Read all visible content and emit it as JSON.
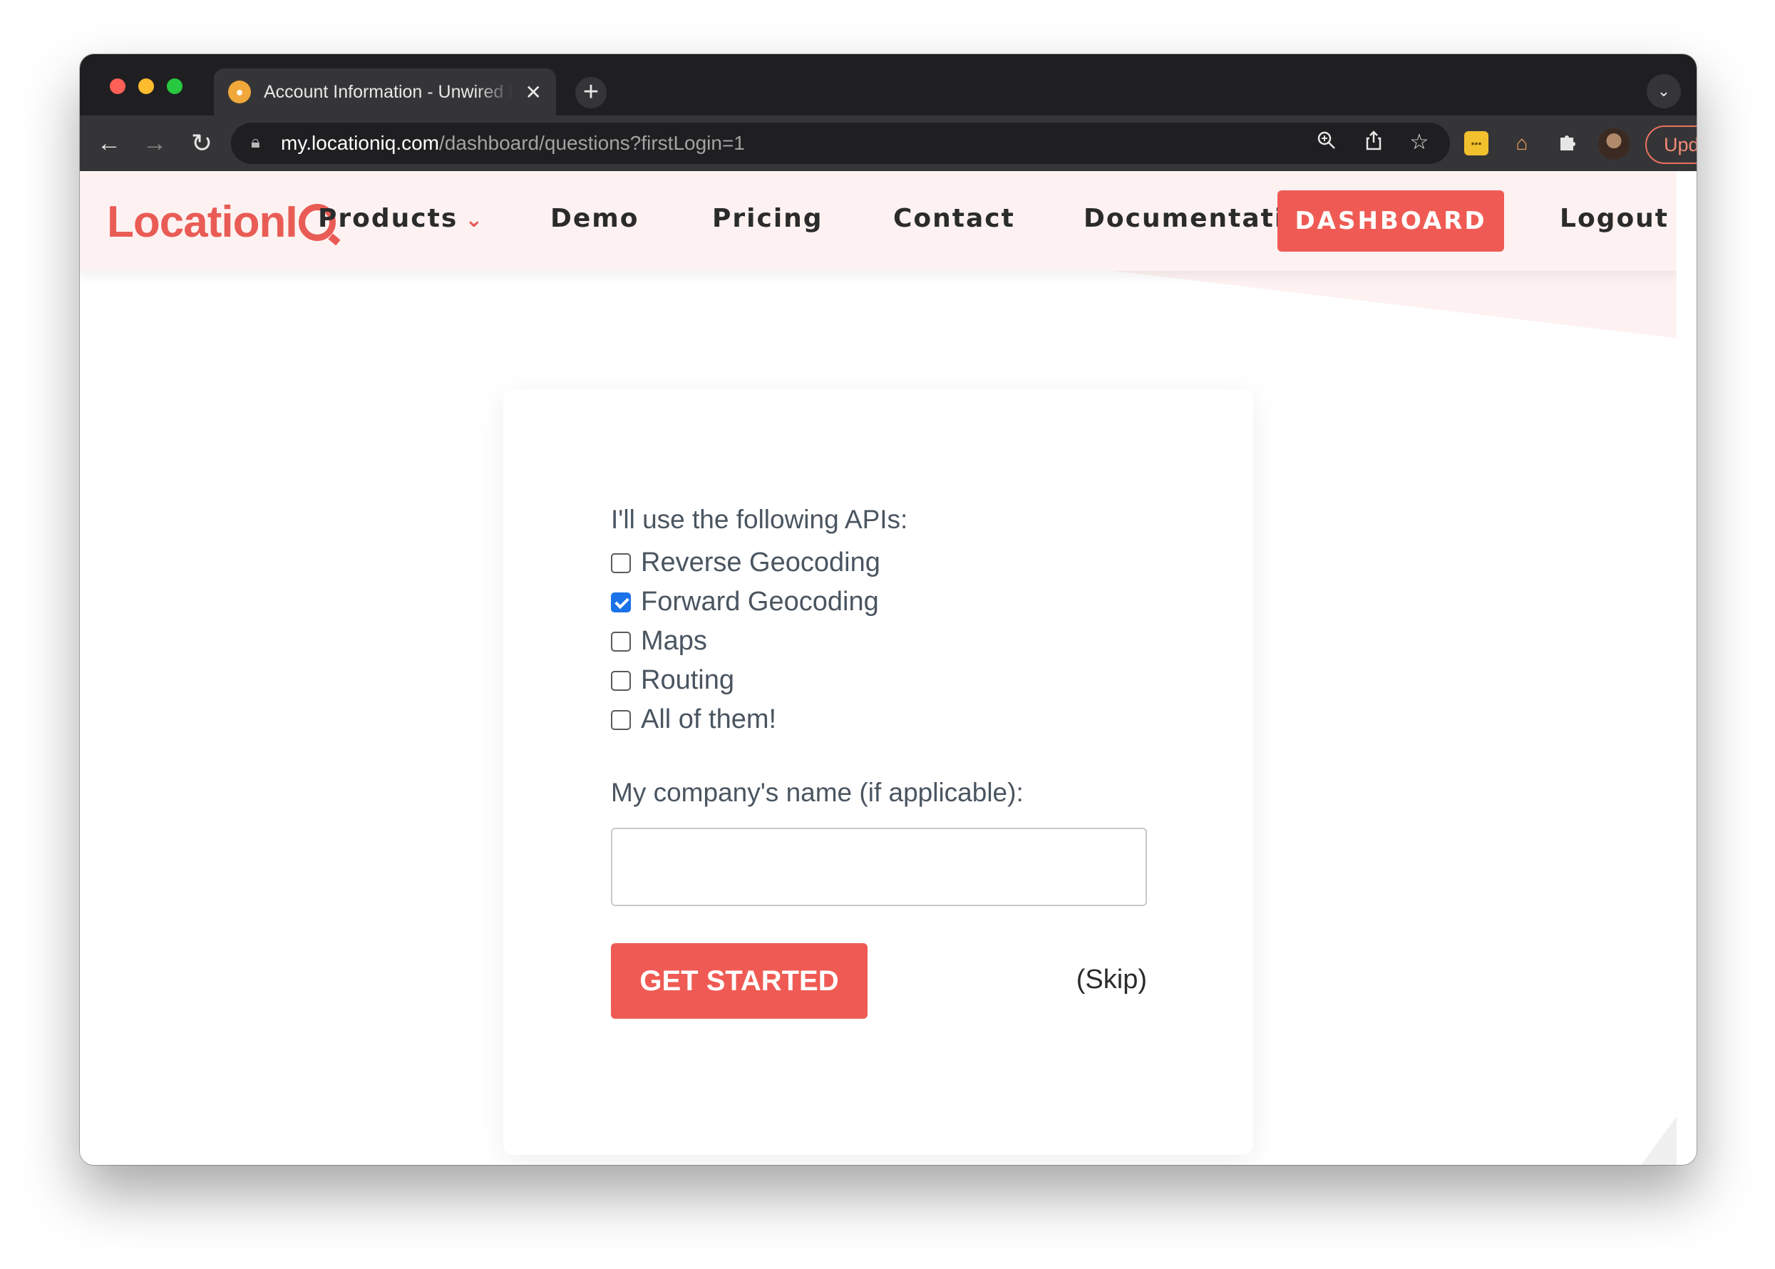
{
  "browser": {
    "tab_title": "Account Information - Unwired Labs",
    "url_host": "my.locationiq.com",
    "url_path": "/dashboard/questions?firstLogin=1",
    "update_label": "Update"
  },
  "navbar": {
    "logo_text": "LocationI",
    "items": {
      "products": "Products",
      "demo": "Demo",
      "pricing": "Pricing",
      "contact": "Contact",
      "documentation": "Documentation",
      "dashboard": "DASHBOARD",
      "logout": "Logout"
    }
  },
  "form": {
    "apis_label": "I'll use the following APIs:",
    "apis": [
      {
        "label": "Reverse Geocoding",
        "checked": false
      },
      {
        "label": "Forward Geocoding",
        "checked": true
      },
      {
        "label": "Maps",
        "checked": false
      },
      {
        "label": "Routing",
        "checked": false
      },
      {
        "label": "All of them!",
        "checked": false
      }
    ],
    "company_label": "My company's name (if applicable):",
    "company_value": "",
    "submit_label": "GET STARTED",
    "skip_label": "(Skip)"
  },
  "colors": {
    "brand": "#ef5b54",
    "nav_bg": "#fdf2f1",
    "checkbox_checked": "#1a73e8"
  }
}
